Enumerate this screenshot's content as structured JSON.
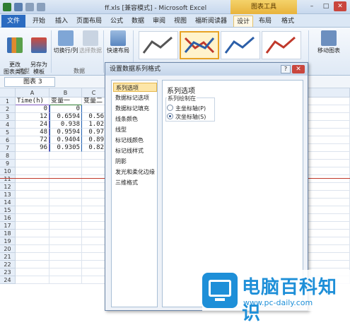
{
  "title_bar": {
    "app_title": "ff.xls [兼容模式] - Microsoft Excel",
    "chart_tools": "图表工具",
    "min": "–",
    "max": "□",
    "close": "✕"
  },
  "tabs": {
    "file": "文件",
    "items": [
      "开始",
      "插入",
      "页面布局",
      "公式",
      "数据",
      "审阅",
      "视图",
      "福昕阅读器",
      "设计",
      "布局",
      "格式"
    ]
  },
  "ribbon": {
    "change_type": "更改\n图表类型",
    "save_template": "另存为\n模板",
    "group_type": "类型",
    "switch_row_col": "切换行/列",
    "select_data": "选择数据",
    "group_data": "数据",
    "quick_layout": "快速布局",
    "move_chart": "移动图表"
  },
  "formula_bar": {
    "name_box": "图表 3"
  },
  "grid": {
    "columns": [
      "A",
      "B",
      "C"
    ],
    "rows": [
      "1",
      "2",
      "3",
      "4",
      "5",
      "6",
      "7",
      "8",
      "9",
      "10",
      "11",
      "12",
      "13",
      "14",
      "15",
      "16",
      "17",
      "18",
      "19",
      "20",
      "21",
      "22",
      "23",
      "24"
    ],
    "header": [
      "Time(h)",
      "变量一",
      "变量二"
    ],
    "data": [
      [
        "0",
        "0",
        ""
      ],
      [
        "12",
        "0.6594",
        "0.56"
      ],
      [
        "24",
        "0.938",
        "1.02"
      ],
      [
        "48",
        "0.9594",
        "0.97"
      ],
      [
        "72",
        "0.9404",
        "0.89"
      ],
      [
        "96",
        "0.9305",
        "0.82"
      ]
    ]
  },
  "dialog": {
    "title": "设置数据系列格式",
    "help": "?",
    "close": "✕",
    "nav": [
      "系列选项",
      "数据标记选项",
      "数据标记填充",
      "线条颜色",
      "线型",
      "标记线颜色",
      "标记线样式",
      "阴影",
      "发光和柔化边缘",
      "三维格式"
    ],
    "panel_title": "系列选项",
    "group_label": "系列绘制在",
    "radio_primary": "主坐标轴(P)",
    "radio_secondary": "次坐标轴(S)",
    "selected_radio": "secondary"
  },
  "watermark": {
    "text": "电脑百科知识",
    "url": "www.pc-daily.com"
  }
}
